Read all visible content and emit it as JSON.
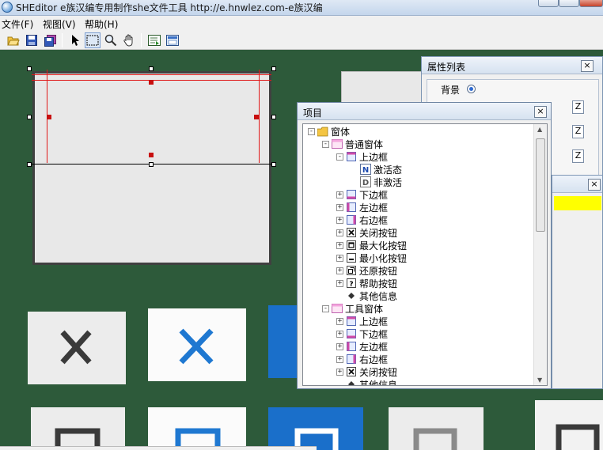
{
  "window": {
    "title": "SHEditor  e族汉编专用制作she文件工具  http://e.hnwlez.com-e族汉编"
  },
  "menu": {
    "items": [
      "文件(F)",
      "视图(V)",
      "帮助(H)"
    ]
  },
  "toolbar": {
    "buttons": [
      "open-folder-icon",
      "save-icon",
      "save-all-icon",
      "pointer-icon",
      "select-rect-icon",
      "zoom-icon",
      "pan-hand-icon",
      "preview-icon",
      "settings-icon"
    ]
  },
  "property_panel": {
    "title": "属性列表",
    "background_label": "背景",
    "field_suffix": "Z",
    "highlight_color": "#ffff00"
  },
  "items_panel": {
    "title": "项目",
    "tree": [
      {
        "label": "窗体",
        "level": 0,
        "icon": "folder-icon",
        "expander": "-"
      },
      {
        "label": "普通窗体",
        "level": 1,
        "icon": "window-icon",
        "expander": "-"
      },
      {
        "label": "上边框",
        "level": 2,
        "icon": "border-top-icon",
        "expander": "-"
      },
      {
        "label": "激活态",
        "level": 3,
        "icon": "letter-n-icon",
        "expander": ""
      },
      {
        "label": "非激活",
        "level": 3,
        "icon": "letter-d-icon",
        "expander": ""
      },
      {
        "label": "下边框",
        "level": 2,
        "icon": "border-bottom-icon",
        "expander": "+"
      },
      {
        "label": "左边框",
        "level": 2,
        "icon": "border-left-icon",
        "expander": "+"
      },
      {
        "label": "右边框",
        "level": 2,
        "icon": "border-right-icon",
        "expander": "+"
      },
      {
        "label": "关闭按钮",
        "level": 2,
        "icon": "close-box-icon",
        "expander": "+"
      },
      {
        "label": "最大化按钮",
        "level": 2,
        "icon": "maximize-box-icon",
        "expander": "+"
      },
      {
        "label": "最小化按钮",
        "level": 2,
        "icon": "minimize-box-icon",
        "expander": "+"
      },
      {
        "label": "还原按钮",
        "level": 2,
        "icon": "restore-box-icon",
        "expander": "+"
      },
      {
        "label": "帮助按钮",
        "level": 2,
        "icon": "help-box-icon",
        "expander": "+"
      },
      {
        "label": "其他信息",
        "level": 2,
        "icon": "diamond-icon",
        "expander": ""
      },
      {
        "label": "工具窗体",
        "level": 1,
        "icon": "window-icon",
        "expander": "-"
      },
      {
        "label": "上边框",
        "level": 2,
        "icon": "border-top-icon",
        "expander": "+"
      },
      {
        "label": "下边框",
        "level": 2,
        "icon": "border-bottom-icon",
        "expander": "+"
      },
      {
        "label": "左边框",
        "level": 2,
        "icon": "border-left-icon",
        "expander": "+"
      },
      {
        "label": "右边框",
        "level": 2,
        "icon": "border-right-icon",
        "expander": "+"
      },
      {
        "label": "关闭按钮",
        "level": 2,
        "icon": "close-box-icon",
        "expander": "+"
      },
      {
        "label": "其他信息",
        "level": 2,
        "icon": "diamond-icon",
        "expander": ""
      }
    ]
  },
  "canvas": {
    "background_color": "#2d5a3a",
    "tiles": [
      "close-gray-icon",
      "close-blue-icon",
      "maximize-gray-icon",
      "maximize-blue-icon",
      "maximize-blue-solid-icon",
      "maximize-light-icon",
      "maximize-dark-icon"
    ]
  }
}
